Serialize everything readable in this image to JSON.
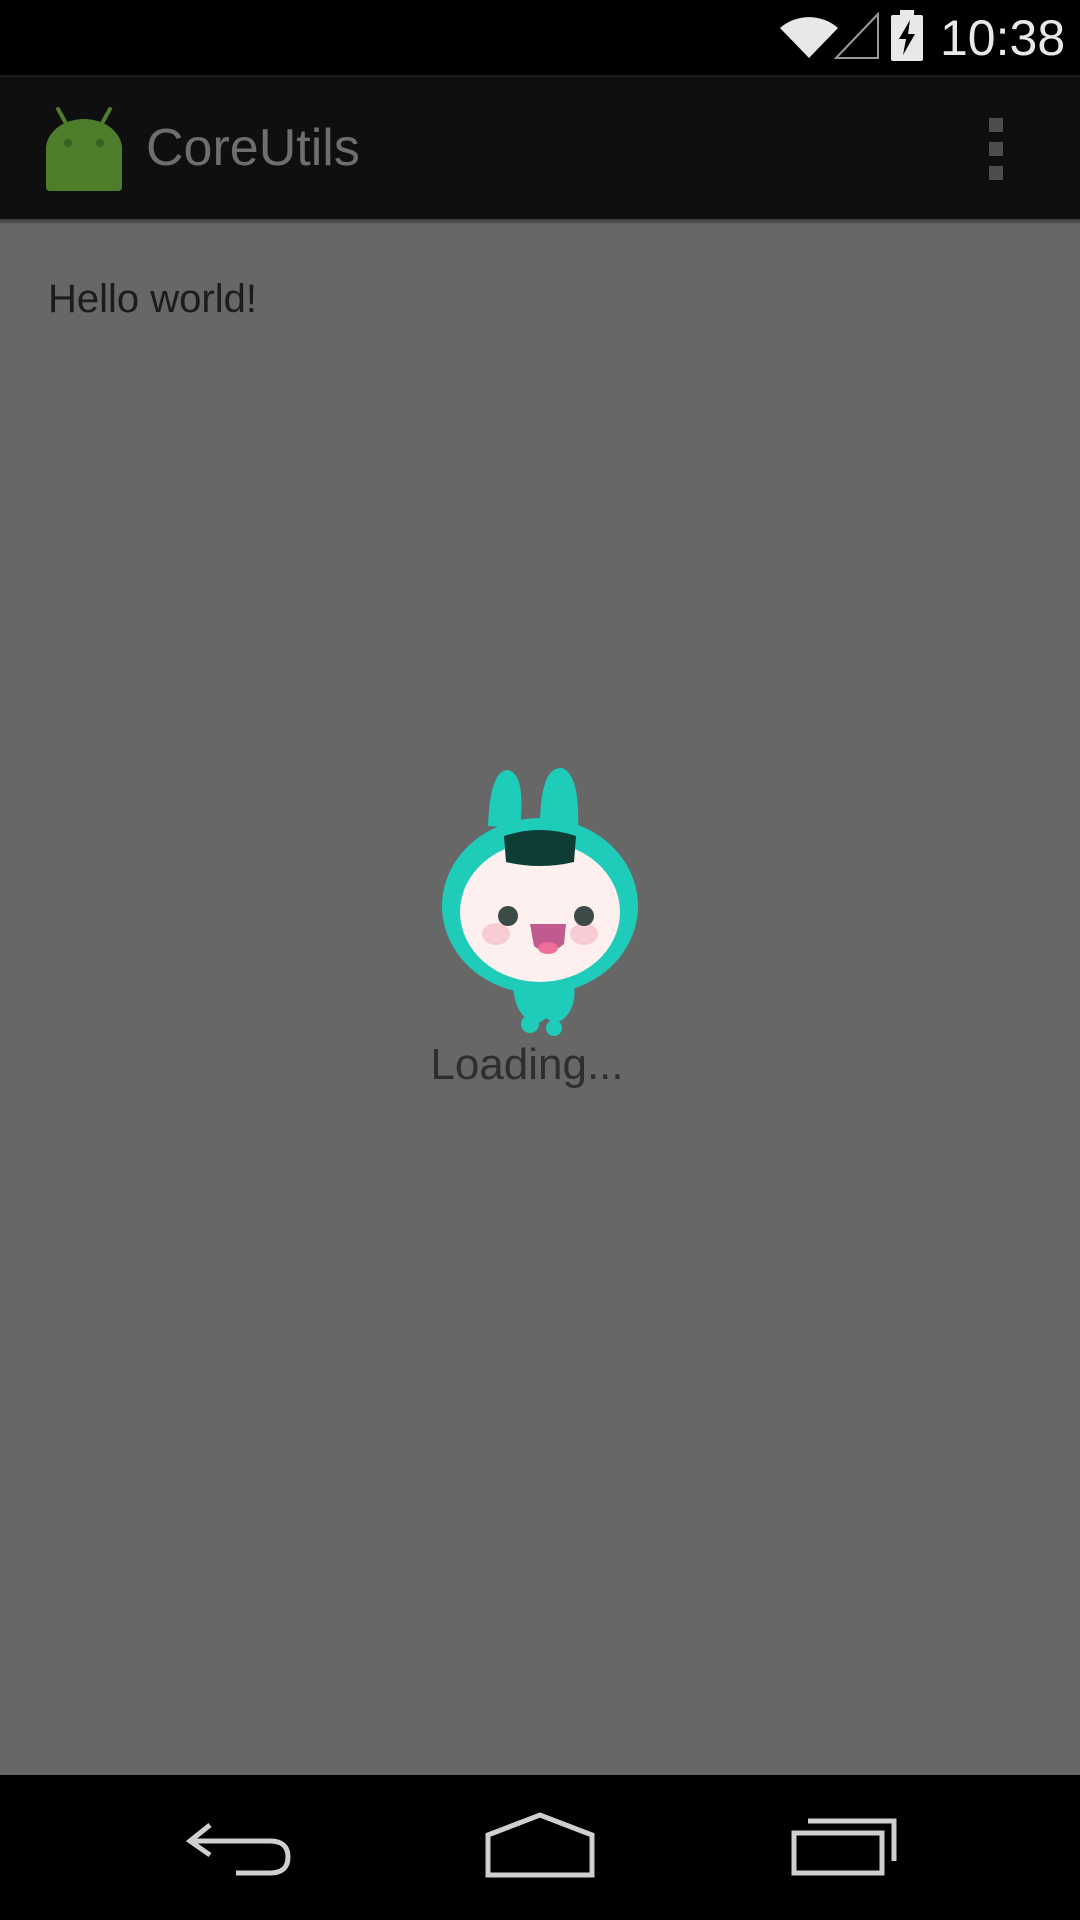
{
  "status_bar": {
    "time": "10:38",
    "icons": [
      "wifi-icon",
      "cell-signal-icon",
      "battery-charging-icon"
    ]
  },
  "action_bar": {
    "app_title": "CoreUtils",
    "app_icon": "android-robot-icon",
    "menu_icon": "overflow-menu-icon"
  },
  "content": {
    "hello_text": "Hello world!",
    "loading_text": "Loading...",
    "mascot": "loading-mascot-icon"
  },
  "nav_bar": {
    "buttons": [
      "back-icon",
      "home-icon",
      "recents-icon"
    ]
  },
  "colors": {
    "content_background": "#676767",
    "mascot_accent": "#1fcbb9",
    "android_green": "#4e7d2c"
  }
}
